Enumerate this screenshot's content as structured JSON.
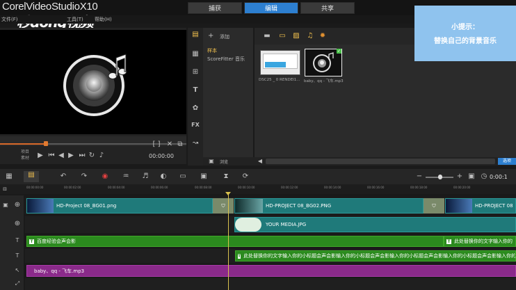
{
  "app": {
    "title_main": "Corel",
    "title_product": "VideoStudio",
    "title_version": "X10"
  },
  "watermark": "秒dong视频",
  "tabs": [
    {
      "label": "捕获"
    },
    {
      "label": "编辑"
    },
    {
      "label": "共享"
    }
  ],
  "menu": {
    "file": "文件(F)",
    "tools": "工具(T)",
    "help": "帮助(H)"
  },
  "player": {
    "mode_project": "项目",
    "mode_clip": "素材",
    "timecode": "00:00:00",
    "ctl_bracket": "[  ]",
    "progress_fraction": 0.25
  },
  "library": {
    "add_label": "添加",
    "folders": [
      {
        "label": "样本",
        "selected": true
      },
      {
        "label": "ScoreFitter 音乐",
        "selected": false
      }
    ],
    "browse_label": "浏览",
    "items": [
      {
        "caption": "DSC25 _ 0 RENDEI1...",
        "kind": "image"
      },
      {
        "caption": "baby、qq - 飞车.mp3",
        "kind": "audio"
      }
    ],
    "options_label": "选项"
  },
  "tip": {
    "title": "小提示：",
    "body": "替换自己的背景音乐"
  },
  "timeline": {
    "timecode": "0:00:1",
    "ticks": [
      "00:00:00:00",
      "00:00:02:00",
      "00:00:04:00",
      "00:00:06:00",
      "00:00:08:00",
      "00:00:10:00",
      "00:00:12:00",
      "00:00:14:00",
      "00:00:16:00",
      "00:00:18:00",
      "00:00:20:00"
    ],
    "video": [
      {
        "label": "HD-Project 08_BG01.png"
      },
      {
        "label": "HD-PROJECT 08_BG02.PNG"
      },
      {
        "label": "HD-PROJECT 08"
      }
    ],
    "overlay": [
      {
        "label": "YOUR MEDIA.JPG"
      }
    ],
    "title1": [
      {
        "label": "百度经验会声会影"
      },
      {
        "label": "此处替换你的文字输入你的"
      }
    ],
    "title2": [
      {
        "label": "此处替换你的文字输入你的小标题会声会影输入你的小标题会声会影输入你的小标题会声会影输入你的小标题会声会影输入你的小标题会声"
      }
    ],
    "music": [
      {
        "label": "baby、qq - 飞车.mp3"
      }
    ]
  },
  "colors": {
    "accent": "#2d7fd0",
    "video_clip": "#1f7a7a",
    "title_clip": "#2b8a1e",
    "audio_clip": "#8a2a8a",
    "tip_bg": "#8fc3ee"
  }
}
